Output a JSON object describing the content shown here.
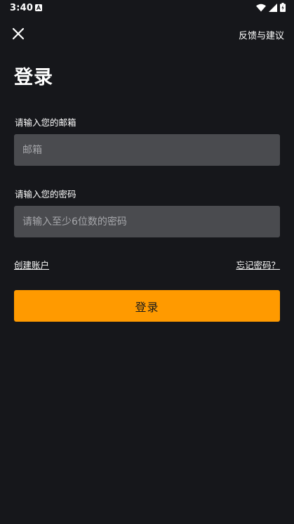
{
  "status_bar": {
    "time": "3:40",
    "icons": [
      "app-notification-icon",
      "wifi-icon",
      "signal-icon",
      "battery-icon"
    ]
  },
  "topbar": {
    "close_icon": "close-icon",
    "feedback_label": "反馈与建议"
  },
  "page": {
    "title": "登录"
  },
  "email": {
    "label": "请输入您的邮箱",
    "placeholder": "邮箱",
    "value": ""
  },
  "password": {
    "label": "请输入您的密码",
    "placeholder": "请输入至少6位数的密码",
    "value": ""
  },
  "links": {
    "create_account": "创建账户",
    "forgot_password": "忘记密码？"
  },
  "login_button": {
    "label": "登录"
  },
  "colors": {
    "background": "#16171b",
    "input_background": "#4a4b4f",
    "accent": "#ff9a00"
  }
}
